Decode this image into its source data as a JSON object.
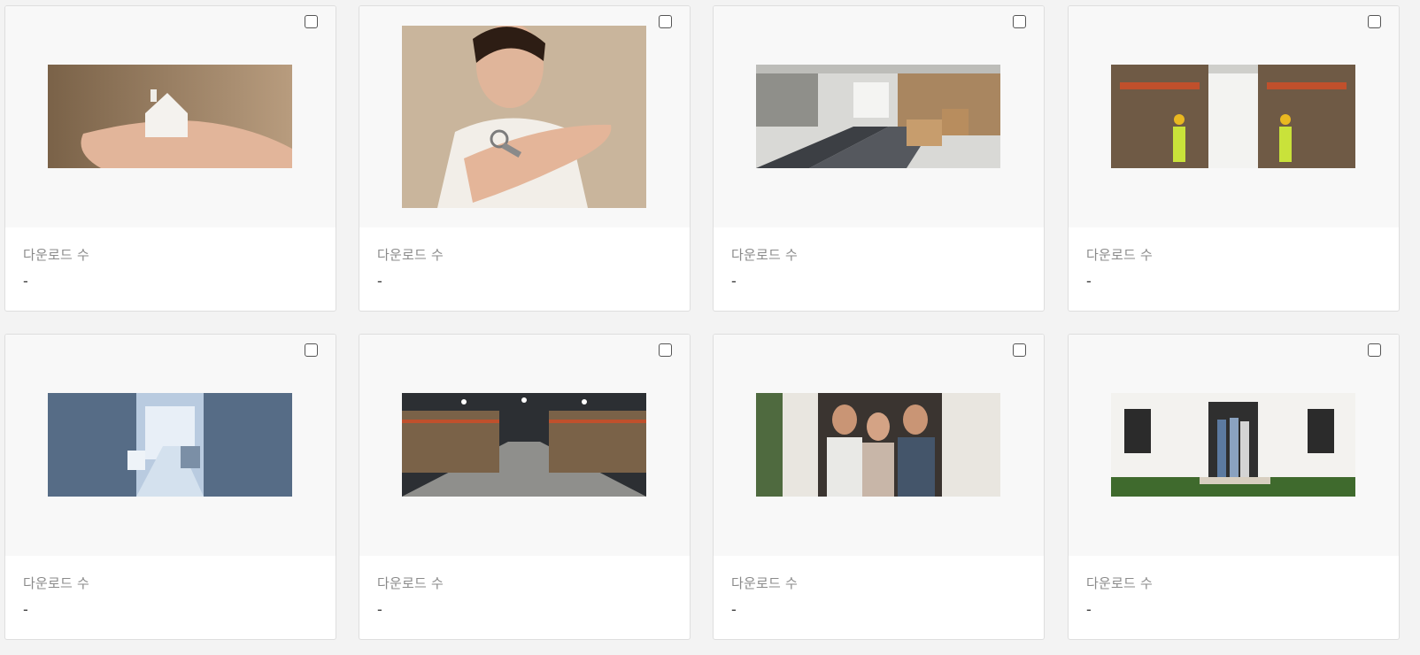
{
  "grid": {
    "cards": [
      {
        "image": "house-in-hand-photo",
        "downloads_label": "다운로드 수",
        "downloads_value": "-"
      },
      {
        "image": "woman-holding-key-photo",
        "downloads_label": "다운로드 수",
        "downloads_value": "-"
      },
      {
        "image": "warehouse-conveyor-photo",
        "downloads_label": "다운로드 수",
        "downloads_value": "-"
      },
      {
        "image": "warehouse-workers-photo",
        "downloads_label": "다운로드 수",
        "downloads_value": "-"
      },
      {
        "image": "automated-warehouse-photo",
        "downloads_label": "다운로드 수",
        "downloads_value": "-"
      },
      {
        "image": "warehouse-aisle-photo",
        "downloads_label": "다운로드 수",
        "downloads_value": "-"
      },
      {
        "image": "family-at-door-keys-photo",
        "downloads_label": "다운로드 수",
        "downloads_value": "-"
      },
      {
        "image": "family-in-front-of-house-photo",
        "downloads_label": "다운로드 수",
        "downloads_value": "-"
      }
    ]
  }
}
